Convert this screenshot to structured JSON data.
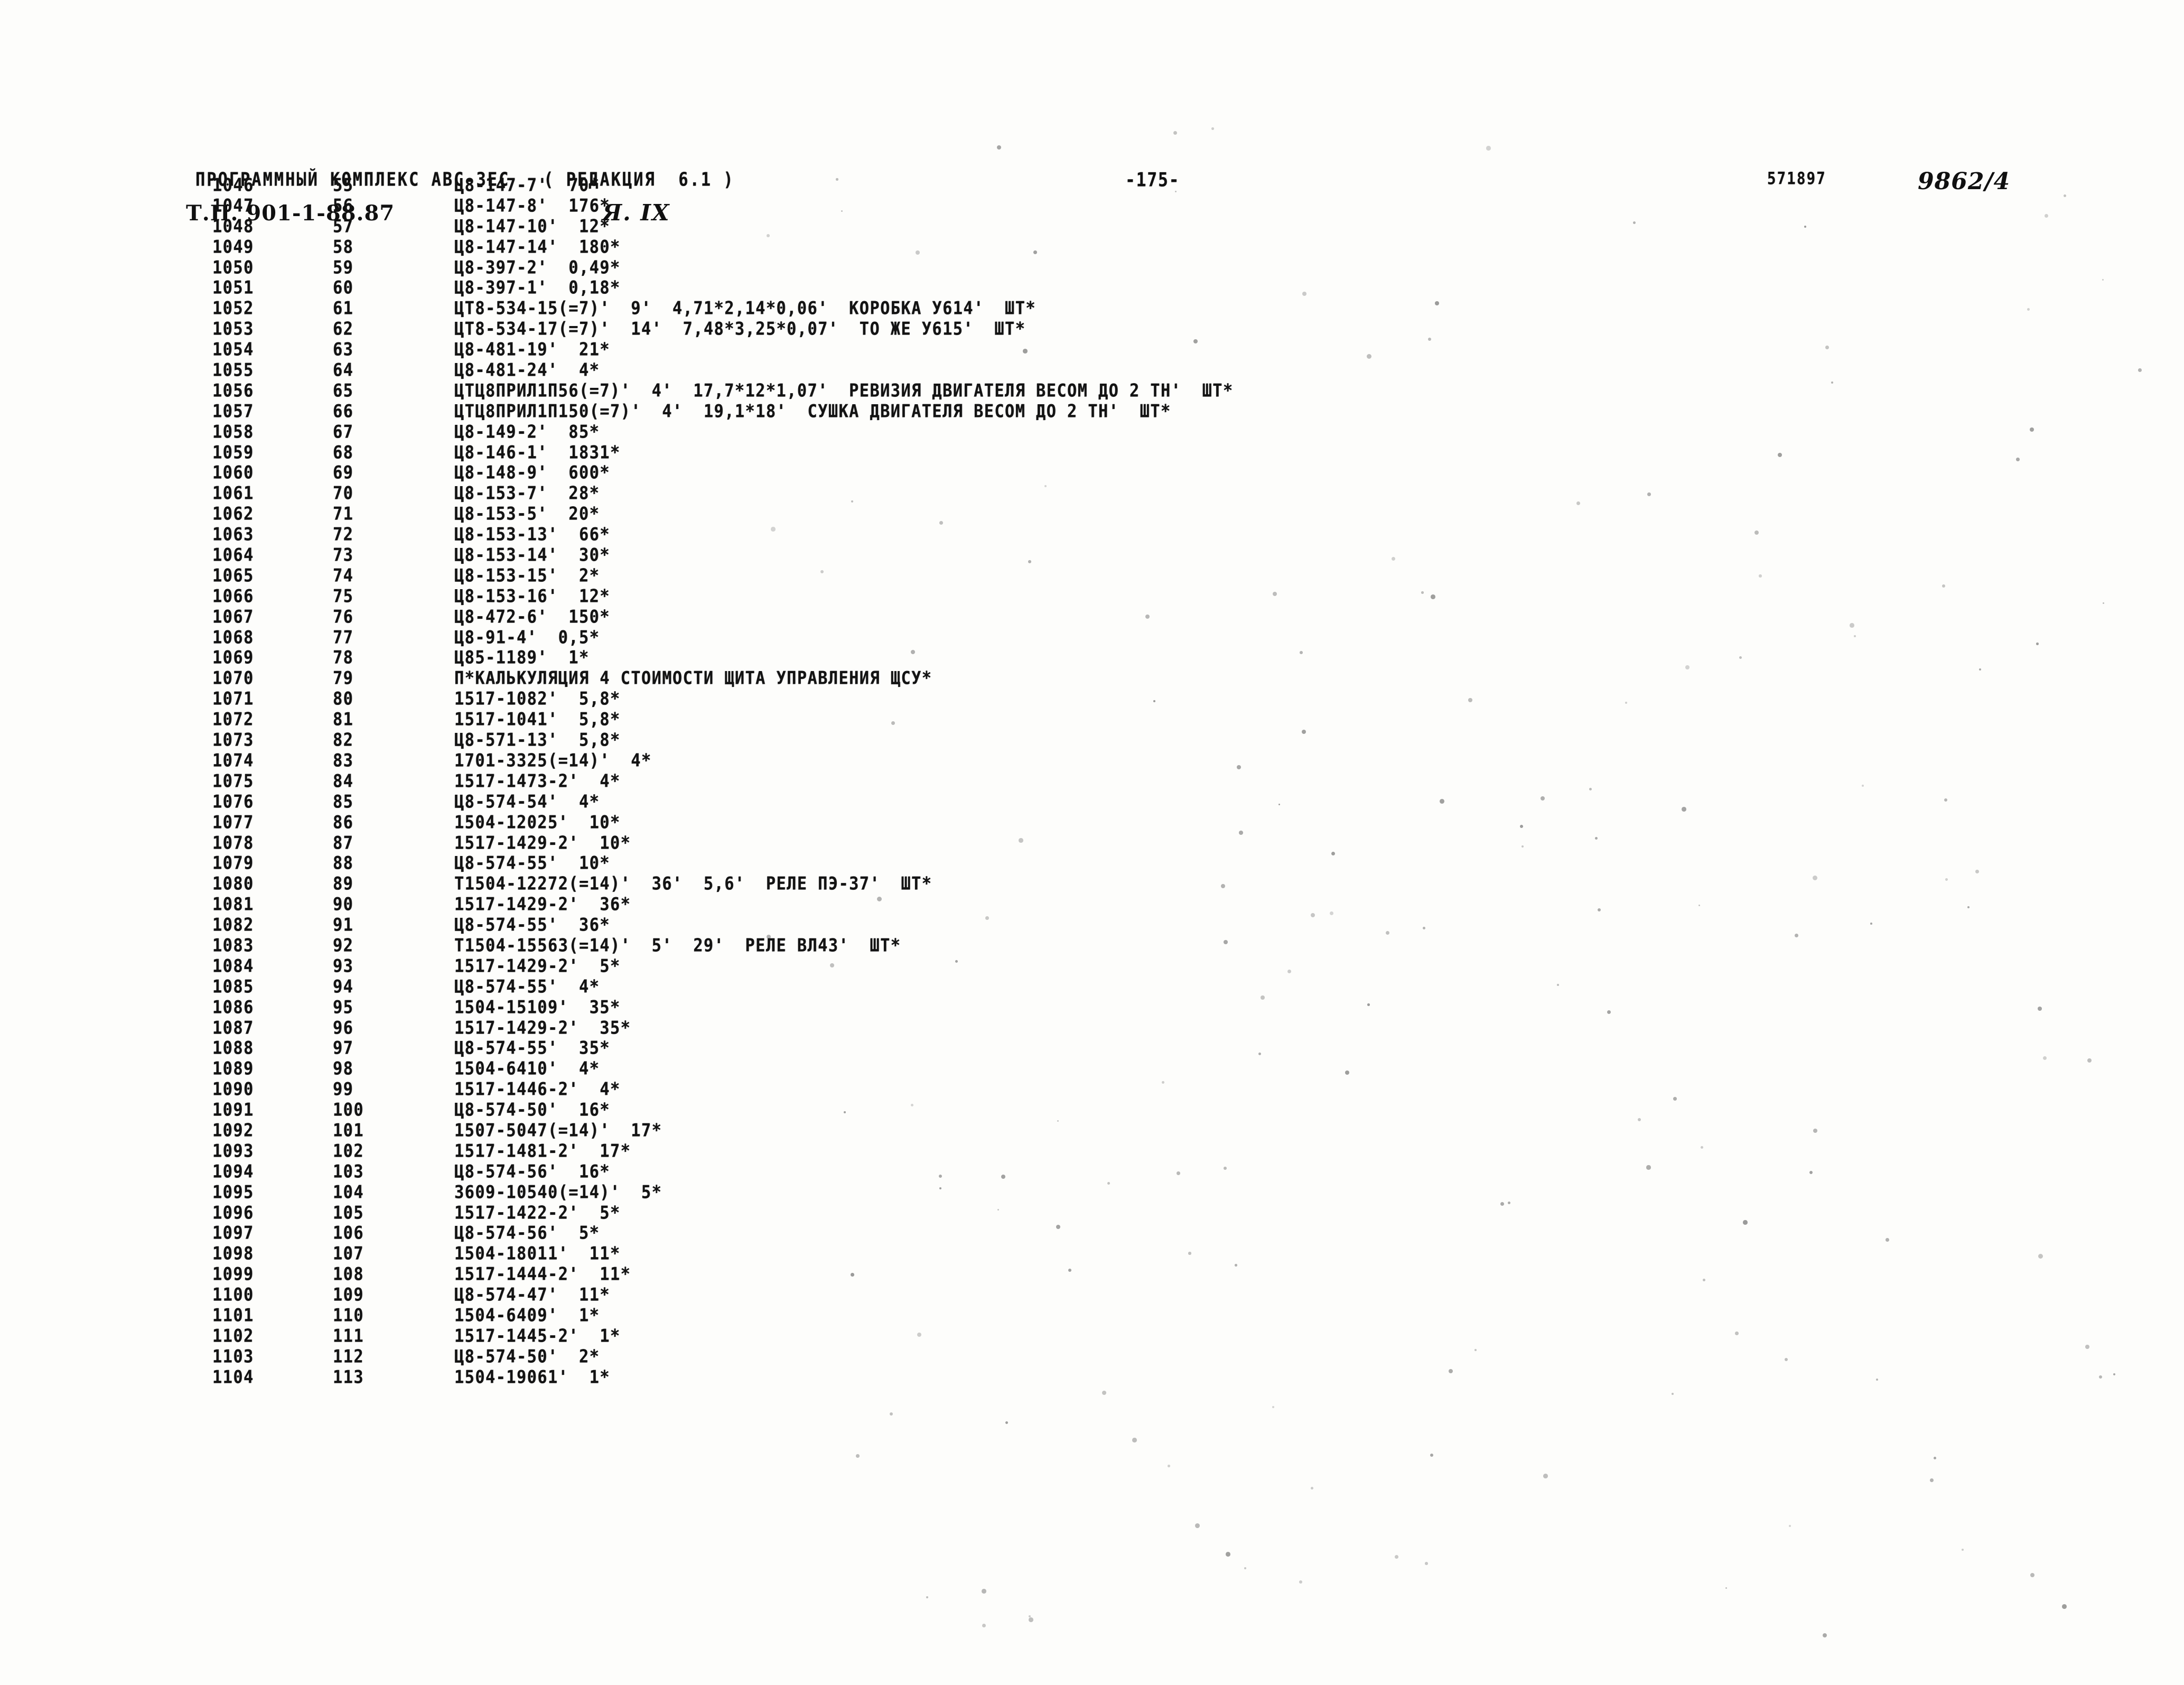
{
  "header": {
    "title": "ПРОГРАММНЫЙ КОМПЛЕКС АВС-3ЕС   ( РЕДАКЦИЯ  6.1 )",
    "page_number": "-175-",
    "archive_code_printed": "571897",
    "archive_code_hand": "9862/4",
    "project_code_hand": "Т.П. 901-1-88.87",
    "section_hand": "Я. IX"
  },
  "listing": {
    "columns": [
      "seq",
      "idx",
      "body"
    ],
    "rows": [
      {
        "seq": "1046",
        "idx": "55",
        "body": "Ц8-147-7'  70*"
      },
      {
        "seq": "1047",
        "idx": "56",
        "body": "Ц8-147-8'  176*"
      },
      {
        "seq": "1048",
        "idx": "57",
        "body": "Ц8-147-10'  12*"
      },
      {
        "seq": "1049",
        "idx": "58",
        "body": "Ц8-147-14'  180*"
      },
      {
        "seq": "1050",
        "idx": "59",
        "body": "Ц8-397-2'  0,49*"
      },
      {
        "seq": "1051",
        "idx": "60",
        "body": "Ц8-397-1'  0,18*"
      },
      {
        "seq": "1052",
        "idx": "61",
        "body": "ЦТ8-534-15(=7)'  9'  4,71*2,14*0,06'  КОРОБКА У614'  ШТ*"
      },
      {
        "seq": "1053",
        "idx": "62",
        "body": "ЦТ8-534-17(=7)'  14'  7,48*3,25*0,07'  ТО ЖЕ У615'  ШТ*"
      },
      {
        "seq": "1054",
        "idx": "63",
        "body": "Ц8-481-19'  21*"
      },
      {
        "seq": "1055",
        "idx": "64",
        "body": "Ц8-481-24'  4*"
      },
      {
        "seq": "1056",
        "idx": "65",
        "body": "ЦТЦ8ПРИЛ1П56(=7)'  4'  17,7*12*1,07'  РЕВИЗИЯ ДВИГАТЕЛЯ ВЕСОМ ДО 2 ТН'  ШТ*"
      },
      {
        "seq": "1057",
        "idx": "66",
        "body": "ЦТЦ8ПРИЛ1П150(=7)'  4'  19,1*18'  СУШКА ДВИГАТЕЛЯ ВЕСОМ ДО 2 ТН'  ШТ*"
      },
      {
        "seq": "1058",
        "idx": "67",
        "body": "Ц8-149-2'  85*"
      },
      {
        "seq": "1059",
        "idx": "68",
        "body": "Ц8-146-1'  1831*"
      },
      {
        "seq": "1060",
        "idx": "69",
        "body": "Ц8-148-9'  600*"
      },
      {
        "seq": "1061",
        "idx": "70",
        "body": "Ц8-153-7'  28*"
      },
      {
        "seq": "1062",
        "idx": "71",
        "body": "Ц8-153-5'  20*"
      },
      {
        "seq": "1063",
        "idx": "72",
        "body": "Ц8-153-13'  66*"
      },
      {
        "seq": "1064",
        "idx": "73",
        "body": "Ц8-153-14'  30*"
      },
      {
        "seq": "1065",
        "idx": "74",
        "body": "Ц8-153-15'  2*"
      },
      {
        "seq": "1066",
        "idx": "75",
        "body": "Ц8-153-16'  12*"
      },
      {
        "seq": "1067",
        "idx": "76",
        "body": "Ц8-472-6'  150*"
      },
      {
        "seq": "1068",
        "idx": "77",
        "body": "Ц8-91-4'  0,5*"
      },
      {
        "seq": "1069",
        "idx": "78",
        "body": "Ц85-1189'  1*"
      },
      {
        "seq": "1070",
        "idx": "79",
        "body": "П*КАЛЬКУЛЯЦИЯ 4 СТОИМОСТИ ЩИТА УПРАВЛЕНИЯ ЩСУ*"
      },
      {
        "seq": "1071",
        "idx": "80",
        "body": "1517-1082'  5,8*"
      },
      {
        "seq": "1072",
        "idx": "81",
        "body": "1517-1041'  5,8*"
      },
      {
        "seq": "1073",
        "idx": "82",
        "body": "Ц8-571-13'  5,8*"
      },
      {
        "seq": "1074",
        "idx": "83",
        "body": "1701-3325(=14)'  4*"
      },
      {
        "seq": "1075",
        "idx": "84",
        "body": "1517-1473-2'  4*"
      },
      {
        "seq": "1076",
        "idx": "85",
        "body": "Ц8-574-54'  4*"
      },
      {
        "seq": "1077",
        "idx": "86",
        "body": "1504-12025'  10*"
      },
      {
        "seq": "1078",
        "idx": "87",
        "body": "1517-1429-2'  10*"
      },
      {
        "seq": "1079",
        "idx": "88",
        "body": "Ц8-574-55'  10*"
      },
      {
        "seq": "1080",
        "idx": "89",
        "body": "Т1504-12272(=14)'  36'  5,6'  РЕЛЕ ПЭ-37'  ШТ*"
      },
      {
        "seq": "1081",
        "idx": "90",
        "body": "1517-1429-2'  36*"
      },
      {
        "seq": "1082",
        "idx": "91",
        "body": "Ц8-574-55'  36*"
      },
      {
        "seq": "1083",
        "idx": "92",
        "body": "Т1504-15563(=14)'  5'  29'  РЕЛЕ ВЛ43'  ШТ*"
      },
      {
        "seq": "1084",
        "idx": "93",
        "body": "1517-1429-2'  5*"
      },
      {
        "seq": "1085",
        "idx": "94",
        "body": "Ц8-574-55'  4*"
      },
      {
        "seq": "1086",
        "idx": "95",
        "body": "1504-15109'  35*"
      },
      {
        "seq": "1087",
        "idx": "96",
        "body": "1517-1429-2'  35*"
      },
      {
        "seq": "1088",
        "idx": "97",
        "body": "Ц8-574-55'  35*"
      },
      {
        "seq": "1089",
        "idx": "98",
        "body": "1504-6410'  4*"
      },
      {
        "seq": "1090",
        "idx": "99",
        "body": "1517-1446-2'  4*"
      },
      {
        "seq": "1091",
        "idx": "100",
        "body": "Ц8-574-50'  16*"
      },
      {
        "seq": "1092",
        "idx": "101",
        "body": "1507-5047(=14)'  17*"
      },
      {
        "seq": "1093",
        "idx": "102",
        "body": "1517-1481-2'  17*"
      },
      {
        "seq": "1094",
        "idx": "103",
        "body": "Ц8-574-56'  16*"
      },
      {
        "seq": "1095",
        "idx": "104",
        "body": "3609-10540(=14)'  5*"
      },
      {
        "seq": "1096",
        "idx": "105",
        "body": "1517-1422-2'  5*"
      },
      {
        "seq": "1097",
        "idx": "106",
        "body": "Ц8-574-56'  5*"
      },
      {
        "seq": "1098",
        "idx": "107",
        "body": "1504-18011'  11*"
      },
      {
        "seq": "1099",
        "idx": "108",
        "body": "1517-1444-2'  11*"
      },
      {
        "seq": "1100",
        "idx": "109",
        "body": "Ц8-574-47'  11*"
      },
      {
        "seq": "1101",
        "idx": "110",
        "body": "1504-6409'  1*"
      },
      {
        "seq": "1102",
        "idx": "111",
        "body": "1517-1445-2'  1*"
      },
      {
        "seq": "1103",
        "idx": "112",
        "body": "Ц8-574-50'  2*"
      },
      {
        "seq": "1104",
        "idx": "113",
        "body": "1504-19061'  1*"
      }
    ]
  }
}
